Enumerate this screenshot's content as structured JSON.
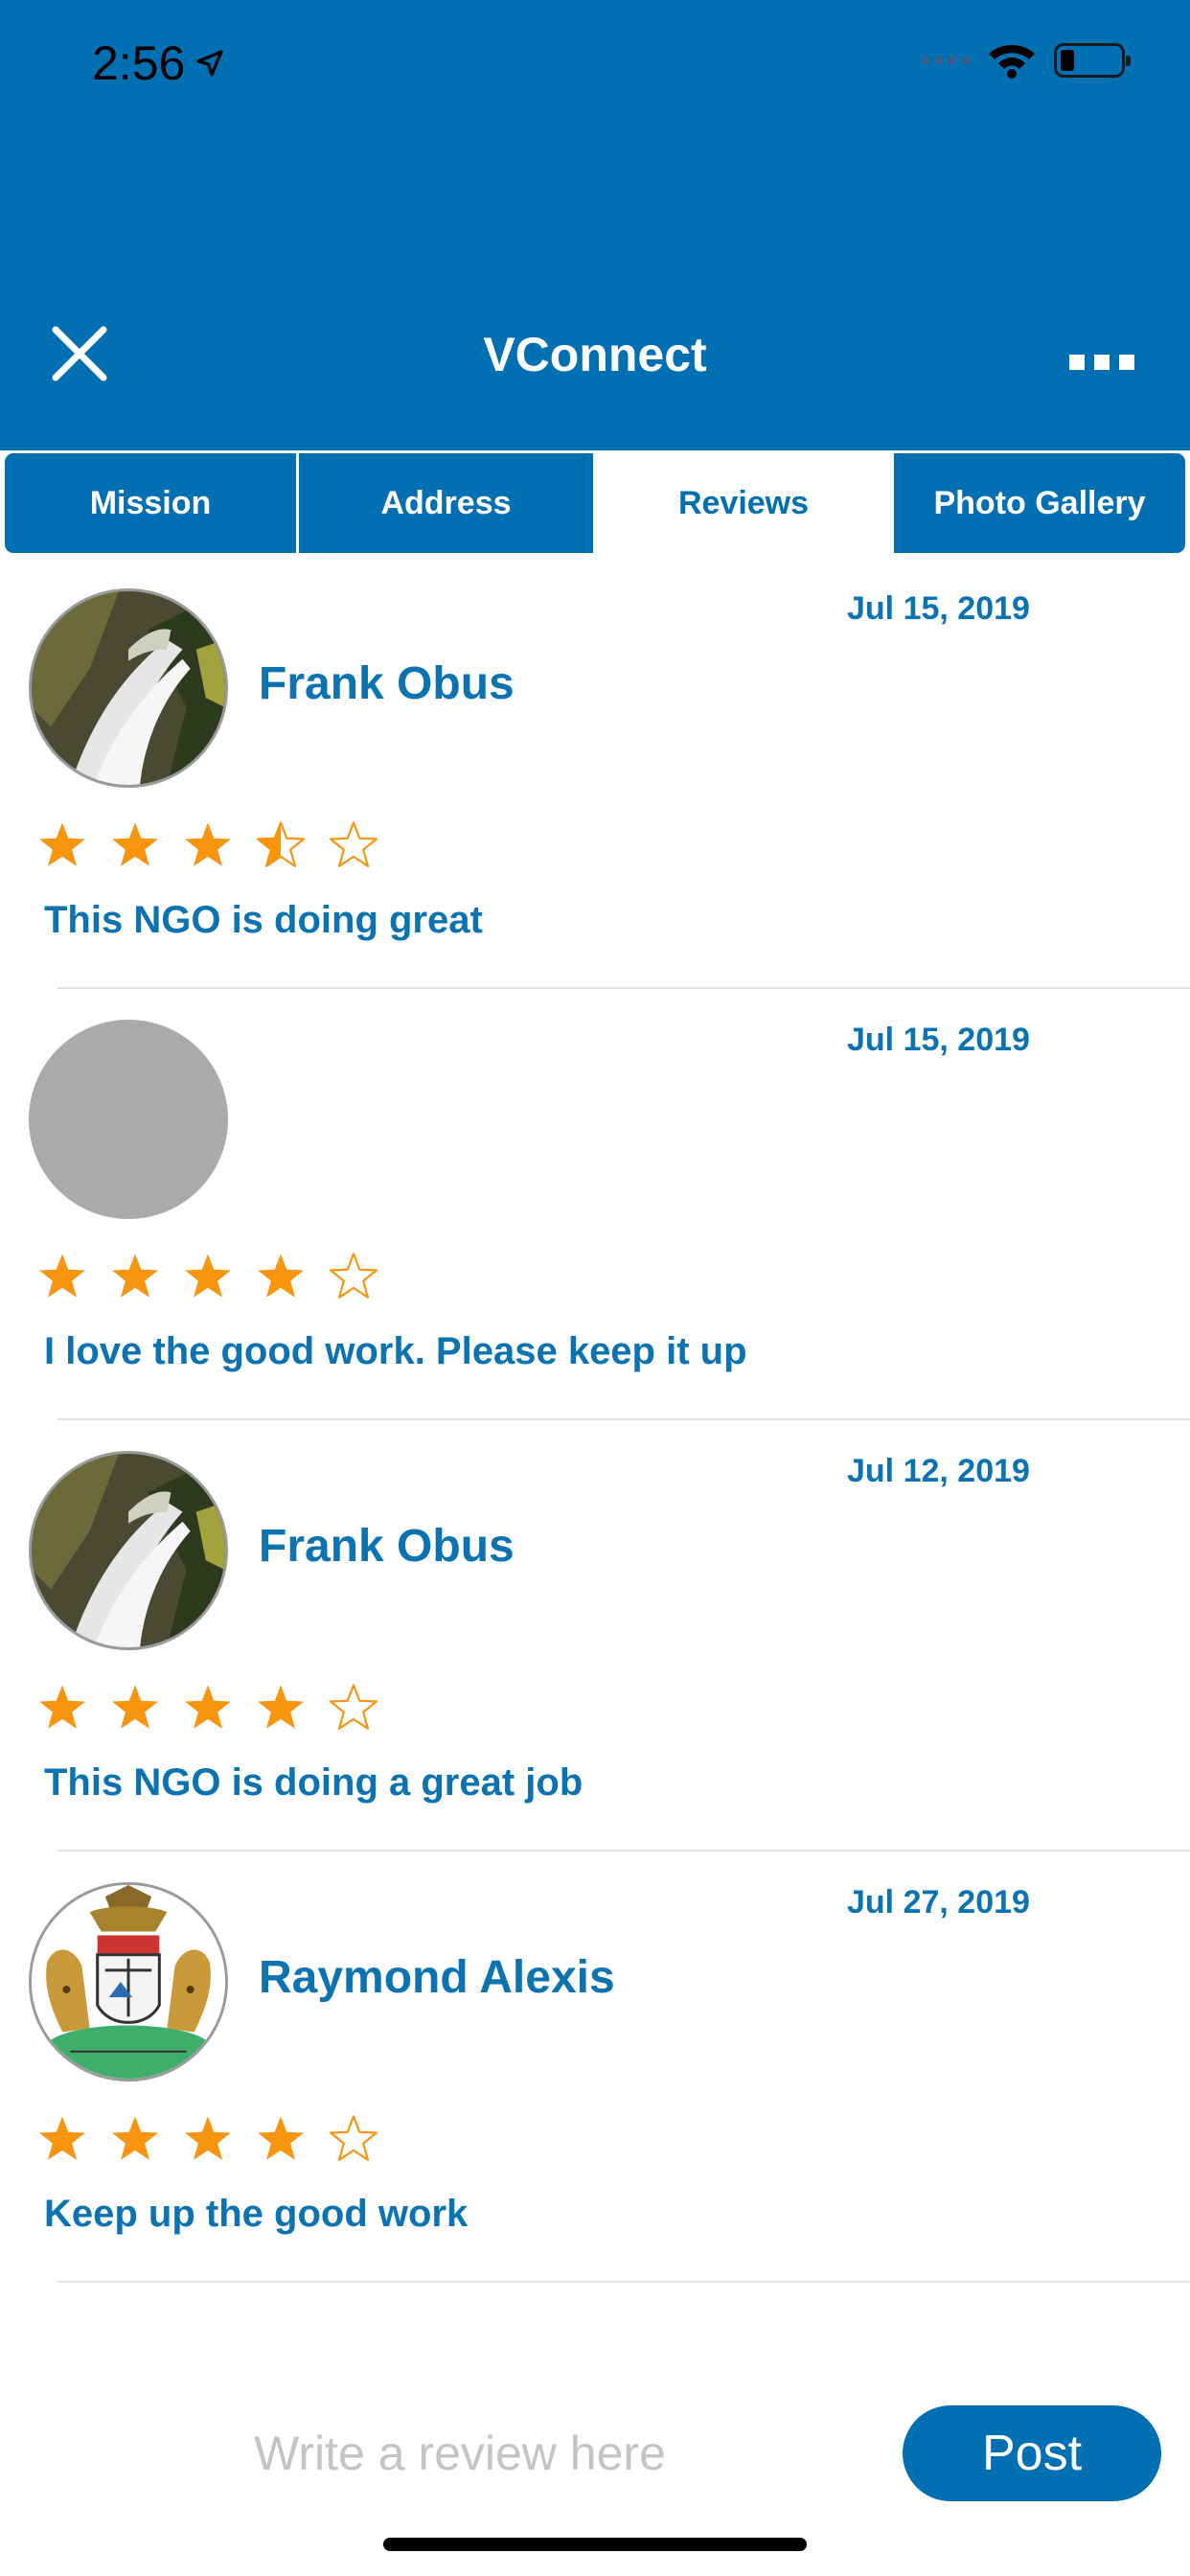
{
  "status_bar": {
    "time": "2:56",
    "icons": [
      "location-arrow-icon",
      "signal-icon",
      "wifi-icon",
      "battery-icon"
    ]
  },
  "header": {
    "title": "VConnect",
    "close_icon": "close-icon",
    "more_icon": "more-horizontal-icon",
    "background_color": "#0070b3"
  },
  "tabs": [
    {
      "label": "Mission",
      "active": false
    },
    {
      "label": "Address",
      "active": false
    },
    {
      "label": "Reviews",
      "active": true
    },
    {
      "label": "Photo Gallery",
      "active": false
    }
  ],
  "reviews": [
    {
      "name": "Frank Obus",
      "date": "Jul 15, 2019",
      "rating": 3.5,
      "text": "This NGO is doing great",
      "avatar": "waterfall-photo"
    },
    {
      "name": "",
      "date": "Jul 15, 2019",
      "rating": 4,
      "text": "I love the good work. Please keep it up",
      "avatar": "blank"
    },
    {
      "name": "Frank Obus",
      "date": "Jul 12, 2019",
      "rating": 4,
      "text": "This NGO is doing a great job",
      "avatar": "waterfall-photo"
    },
    {
      "name": "Raymond Alexis",
      "date": "Jul 27, 2019",
      "rating": 4,
      "text": "Keep up the good work",
      "avatar": "coat-of-arms"
    }
  ],
  "composer": {
    "placeholder": "Write a review here",
    "post_label": "Post"
  },
  "colors": {
    "accent": "#0070b3",
    "text_blue": "#0b73b1",
    "star": "#f7950f"
  }
}
